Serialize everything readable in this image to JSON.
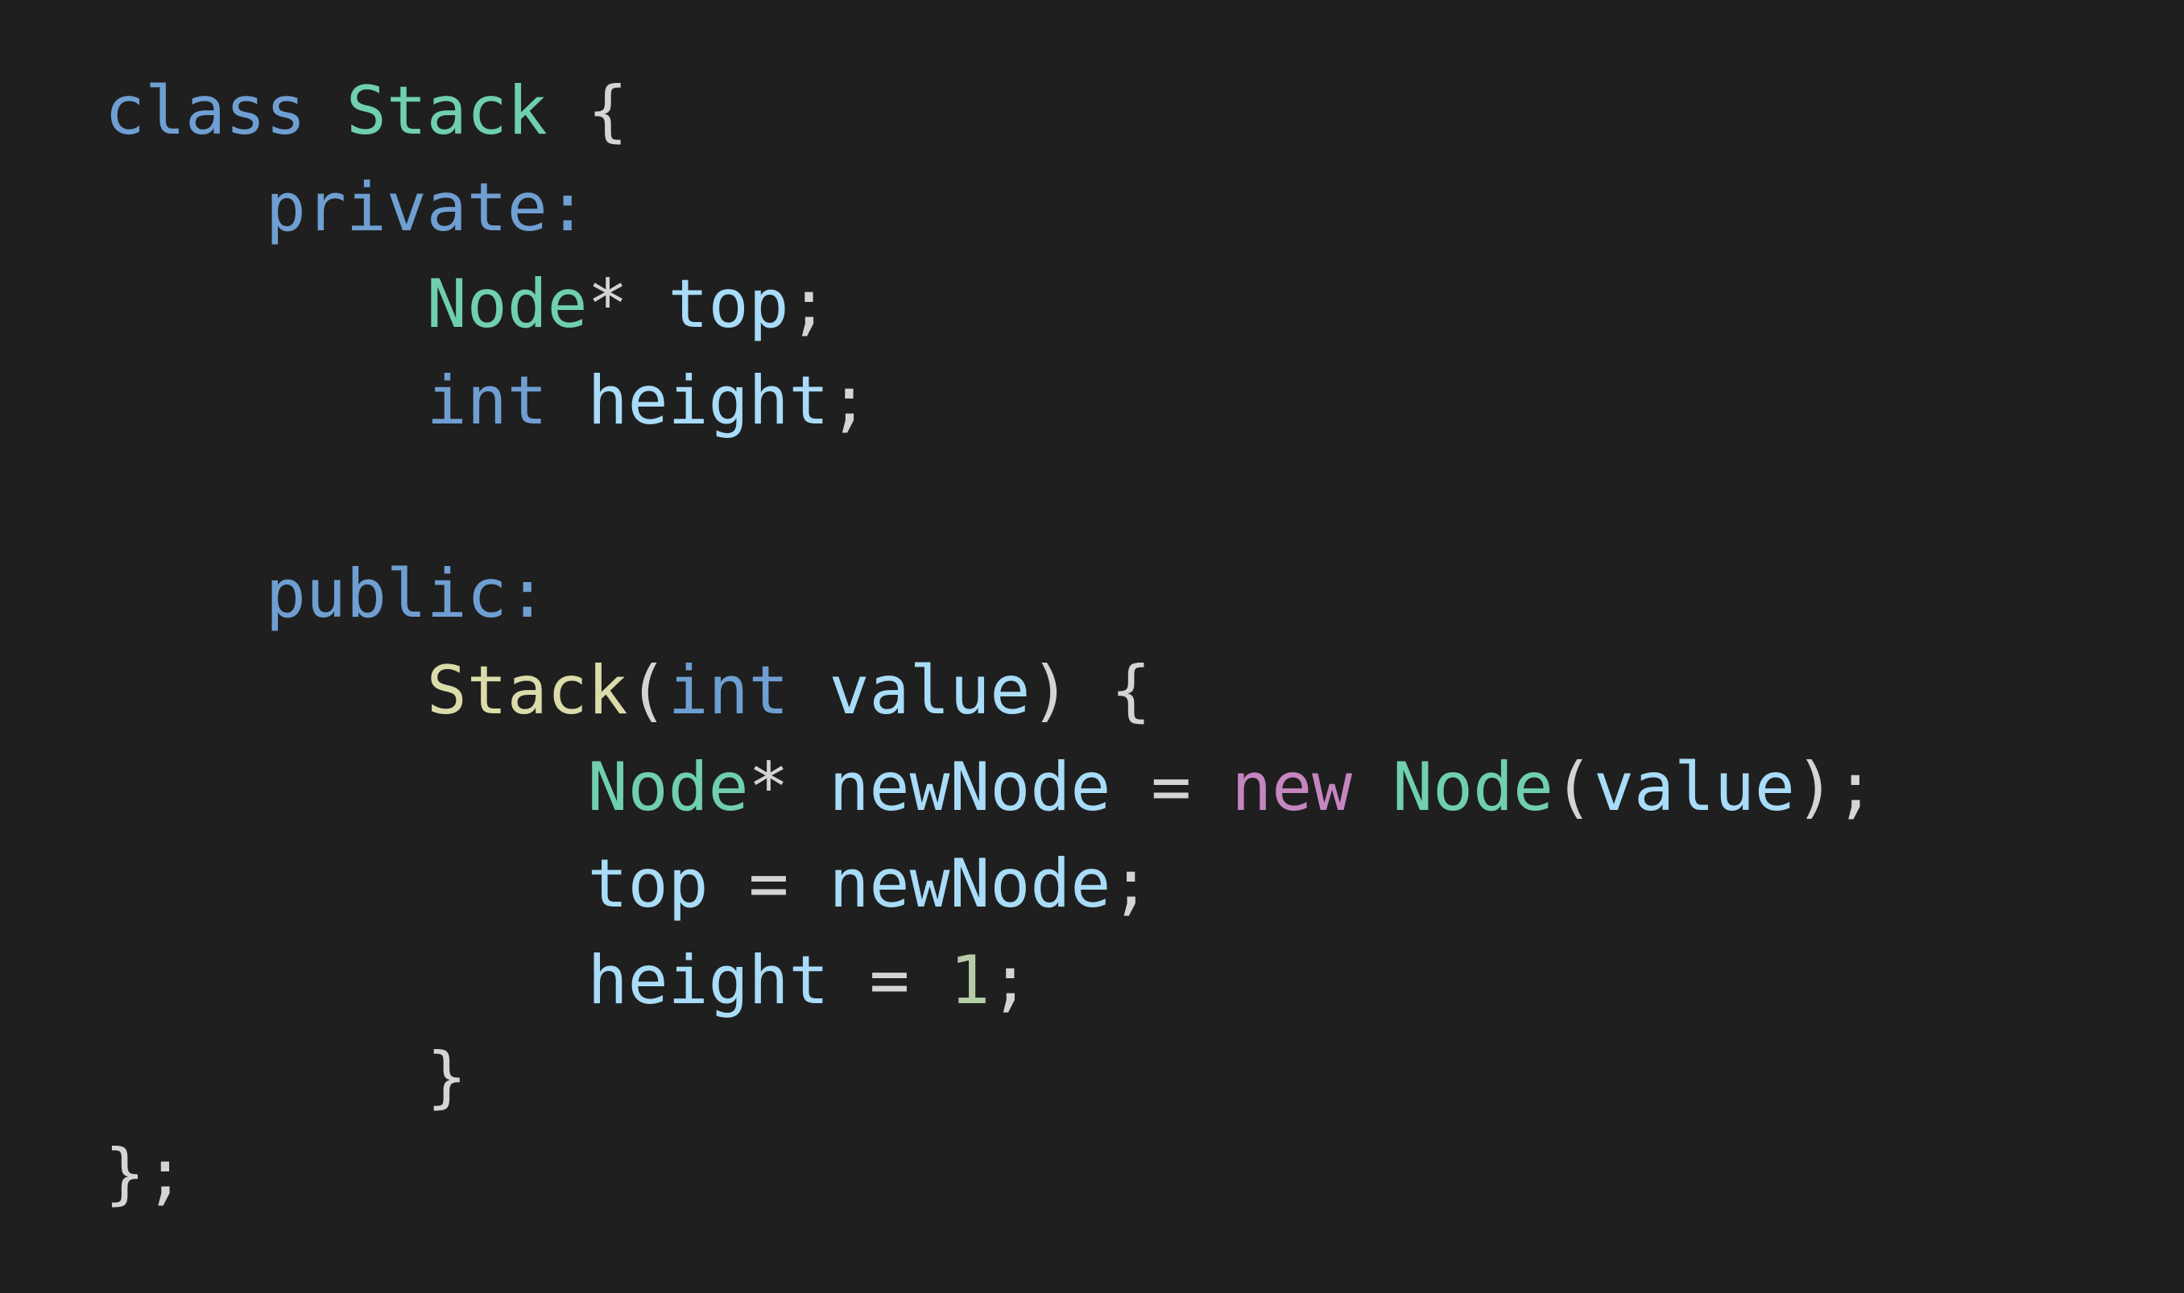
{
  "colors": {
    "background": "#1f1f1f",
    "keyword": "#6f9fd2",
    "type": "#6fcfaf",
    "variable": "#a8dcf8",
    "function": "#dcdcaa",
    "operator_new": "#c586c0",
    "number": "#b5cea8",
    "punctuation": "#d4d4d4"
  },
  "code": {
    "language": "C++",
    "lines": [
      [
        {
          "text": "class",
          "kind": "keyword"
        },
        {
          "text": " ",
          "kind": "punctuation"
        },
        {
          "text": "Stack",
          "kind": "type"
        },
        {
          "text": " {",
          "kind": "punctuation"
        }
      ],
      [
        {
          "text": "    ",
          "kind": "punctuation"
        },
        {
          "text": "private",
          "kind": "keyword"
        },
        {
          "text": ":",
          "kind": "keyword"
        }
      ],
      [
        {
          "text": "        ",
          "kind": "punctuation"
        },
        {
          "text": "Node",
          "kind": "type"
        },
        {
          "text": "*",
          "kind": "punctuation"
        },
        {
          "text": " ",
          "kind": "punctuation"
        },
        {
          "text": "top",
          "kind": "variable"
        },
        {
          "text": ";",
          "kind": "punctuation"
        }
      ],
      [
        {
          "text": "        ",
          "kind": "punctuation"
        },
        {
          "text": "int",
          "kind": "keyword"
        },
        {
          "text": " ",
          "kind": "punctuation"
        },
        {
          "text": "height",
          "kind": "variable"
        },
        {
          "text": ";",
          "kind": "punctuation"
        }
      ],
      [],
      [
        {
          "text": "    ",
          "kind": "punctuation"
        },
        {
          "text": "public",
          "kind": "keyword"
        },
        {
          "text": ":",
          "kind": "keyword"
        }
      ],
      [
        {
          "text": "        ",
          "kind": "punctuation"
        },
        {
          "text": "Stack",
          "kind": "function"
        },
        {
          "text": "(",
          "kind": "punctuation"
        },
        {
          "text": "int",
          "kind": "keyword"
        },
        {
          "text": " ",
          "kind": "punctuation"
        },
        {
          "text": "value",
          "kind": "variable"
        },
        {
          "text": ") {",
          "kind": "punctuation"
        }
      ],
      [
        {
          "text": "            ",
          "kind": "punctuation"
        },
        {
          "text": "Node",
          "kind": "type"
        },
        {
          "text": "*",
          "kind": "punctuation"
        },
        {
          "text": " ",
          "kind": "punctuation"
        },
        {
          "text": "newNode",
          "kind": "variable"
        },
        {
          "text": " = ",
          "kind": "punctuation"
        },
        {
          "text": "new",
          "kind": "operator_new"
        },
        {
          "text": " ",
          "kind": "punctuation"
        },
        {
          "text": "Node",
          "kind": "type"
        },
        {
          "text": "(",
          "kind": "punctuation"
        },
        {
          "text": "value",
          "kind": "variable"
        },
        {
          "text": ");",
          "kind": "punctuation"
        }
      ],
      [
        {
          "text": "            ",
          "kind": "punctuation"
        },
        {
          "text": "top",
          "kind": "variable"
        },
        {
          "text": " = ",
          "kind": "punctuation"
        },
        {
          "text": "newNode",
          "kind": "variable"
        },
        {
          "text": ";",
          "kind": "punctuation"
        }
      ],
      [
        {
          "text": "            ",
          "kind": "punctuation"
        },
        {
          "text": "height",
          "kind": "variable"
        },
        {
          "text": " = ",
          "kind": "punctuation"
        },
        {
          "text": "1",
          "kind": "number"
        },
        {
          "text": ";",
          "kind": "punctuation"
        }
      ],
      [
        {
          "text": "        ",
          "kind": "punctuation"
        },
        {
          "text": "}",
          "kind": "punctuation"
        }
      ],
      [
        {
          "text": "};",
          "kind": "punctuation"
        }
      ]
    ]
  }
}
